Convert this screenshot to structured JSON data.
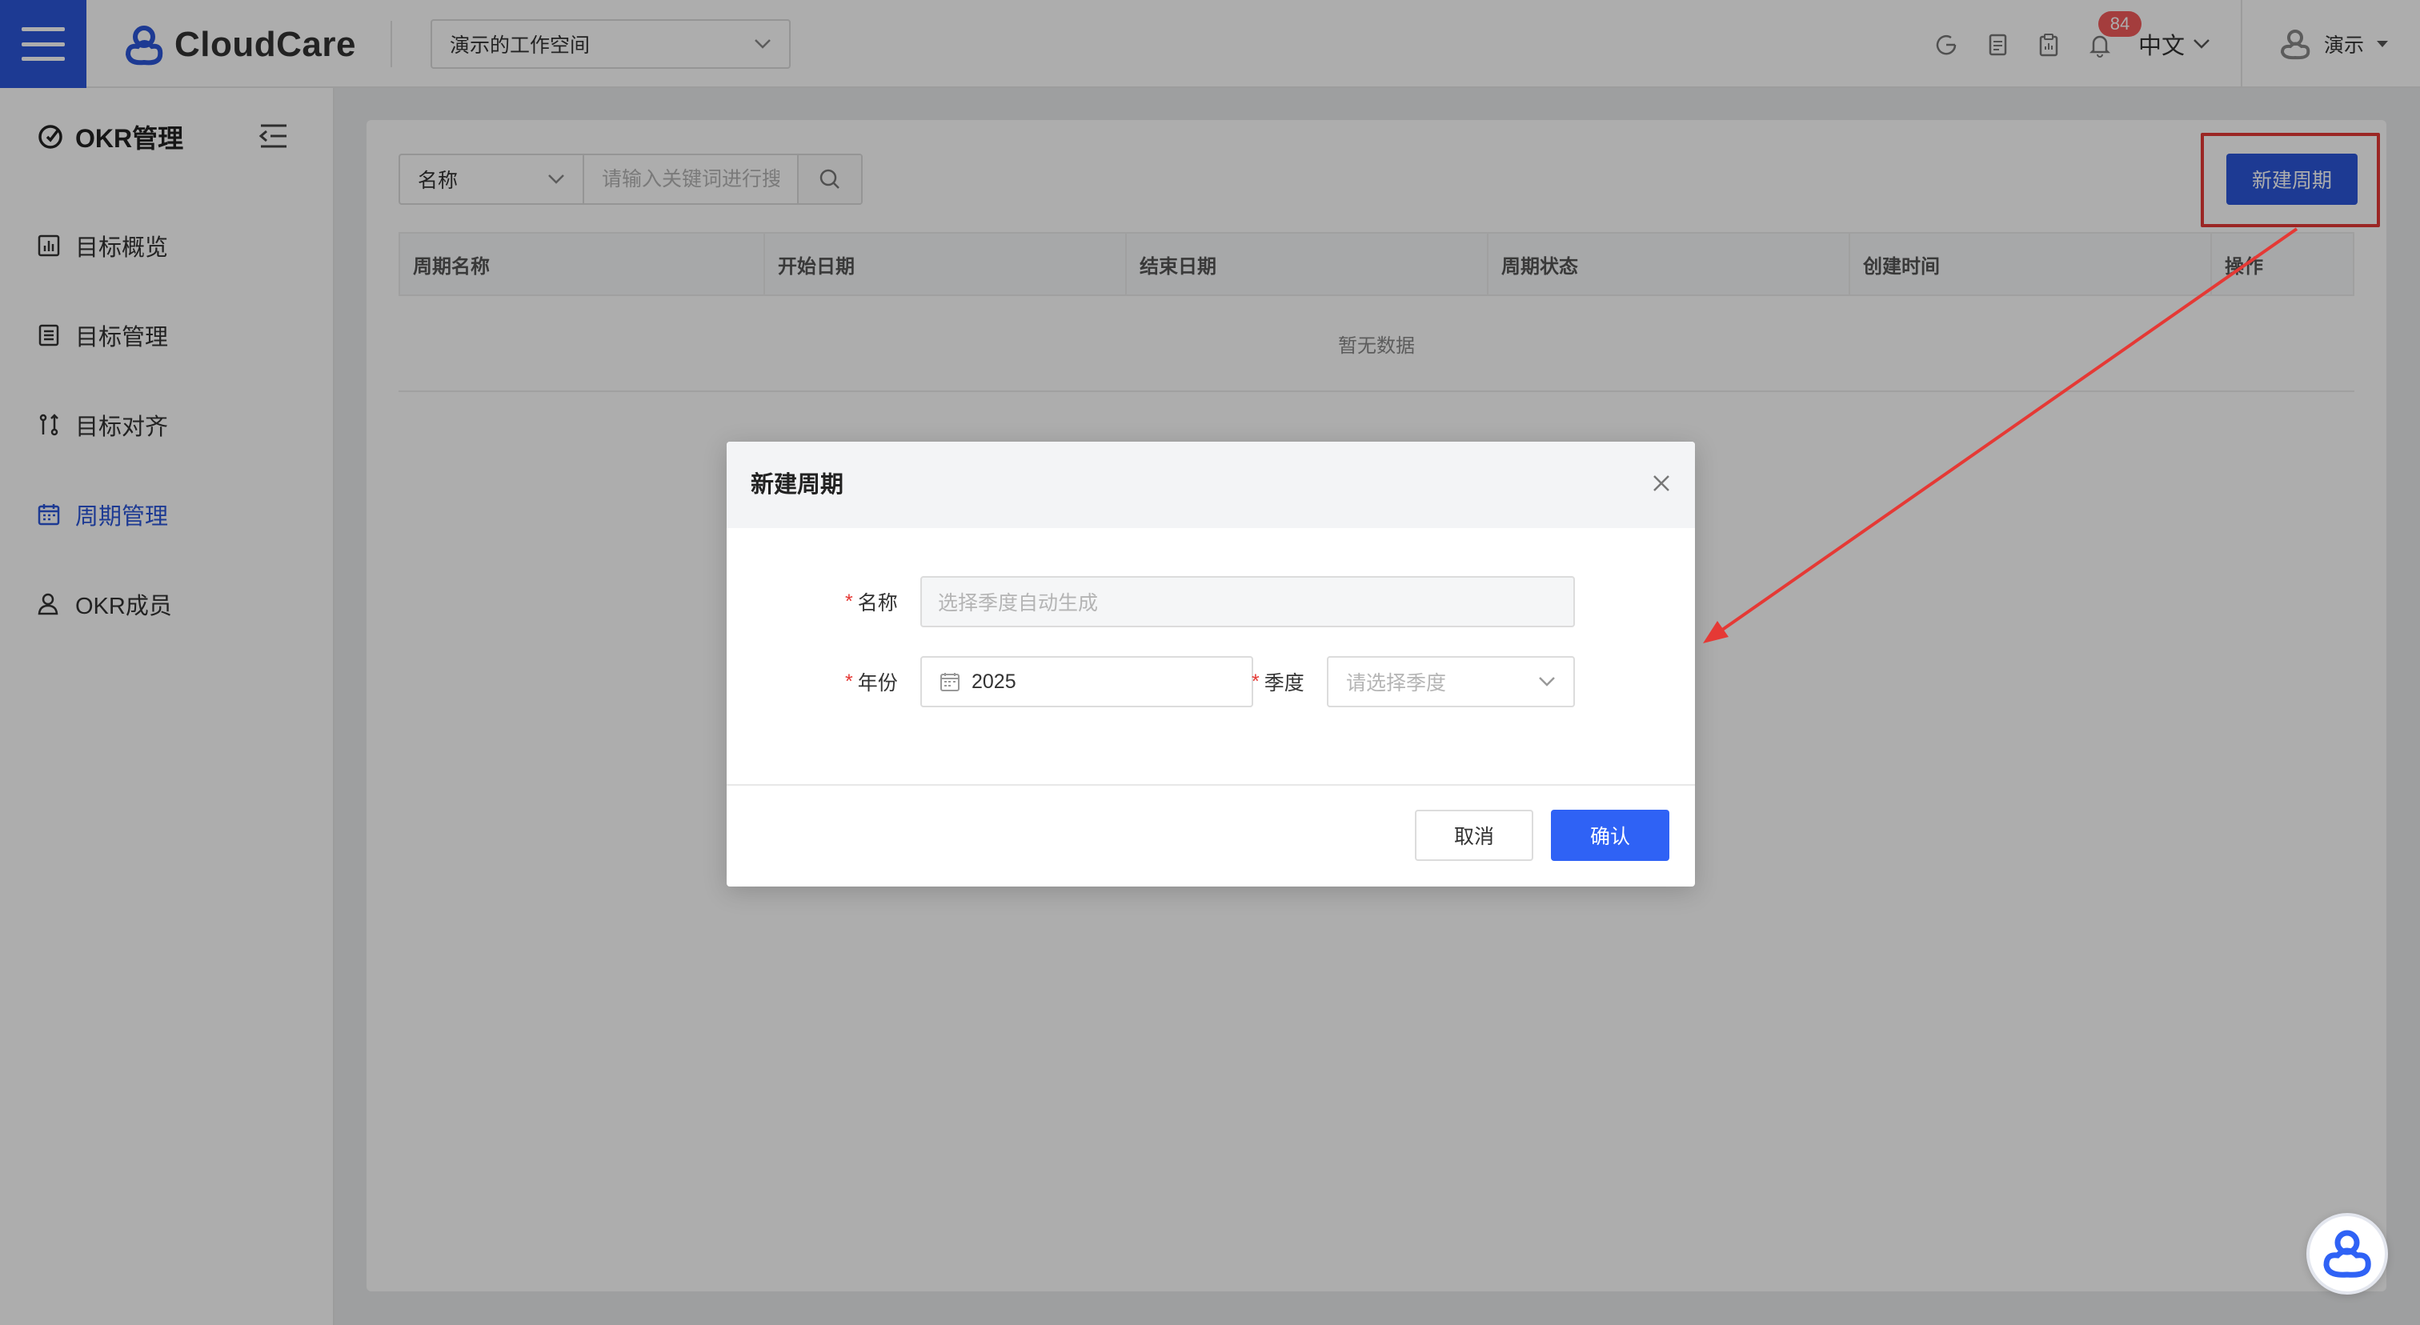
{
  "header": {
    "brand": "CloudCare",
    "workspace": "演示的工作空间",
    "notification_count": "84",
    "language": "中文",
    "user_name": "演示"
  },
  "sidebar": {
    "title": "OKR管理",
    "items": [
      {
        "label": "目标概览",
        "icon": "bar-chart-icon",
        "active": false
      },
      {
        "label": "目标管理",
        "icon": "list-icon",
        "active": false
      },
      {
        "label": "目标对齐",
        "icon": "align-icon",
        "active": false
      },
      {
        "label": "周期管理",
        "icon": "calendar-icon",
        "active": true
      },
      {
        "label": "OKR成员",
        "icon": "member-icon",
        "active": false
      }
    ]
  },
  "toolbar": {
    "field_select": "名称",
    "search_placeholder": "请输入关键词进行搜索",
    "new_button": "新建周期"
  },
  "table": {
    "columns": [
      "周期名称",
      "开始日期",
      "结束日期",
      "周期状态",
      "创建时间",
      "操作"
    ],
    "empty_text": "暂无数据"
  },
  "modal": {
    "title": "新建周期",
    "name_label": "名称",
    "name_placeholder": "选择季度自动生成",
    "year_label": "年份",
    "year_value": "2025",
    "quarter_label": "季度",
    "quarter_placeholder": "请选择季度",
    "cancel_label": "取消",
    "confirm_label": "确认"
  },
  "colors": {
    "primary": "#2b56d9",
    "confirm": "#2f62f5",
    "annotation": "#e53935",
    "badge": "#f25a5a"
  }
}
